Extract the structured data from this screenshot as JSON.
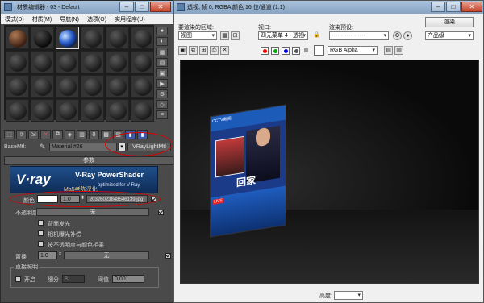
{
  "material_editor": {
    "title": "材质编辑器 - 03 - Default",
    "menu": [
      "模式(D)",
      "材质(M)",
      "导航(N)",
      "选项(O)",
      "实用程序(U)"
    ],
    "basemtl_label": "BaseMtl:",
    "material_name": "Material #26",
    "material_type": "VRayLightMtl",
    "rollout_title": "参数",
    "banner": {
      "logo": "V·ray",
      "title": "V-Ray PowerShader",
      "subtitle": "optimized for V-Ray",
      "extra": "Ma5老陈汉化"
    },
    "color_label": "颜色",
    "color_multiplier": "1.0",
    "texture_name": "20326023848546139.jpg)",
    "opacity_label": "不透明度",
    "opacity_map": "无",
    "checkboxes": [
      {
        "label": "背面发光",
        "checked": false
      },
      {
        "label": "相机曝光补偿",
        "checked": false
      },
      {
        "label": "按不透明度与颜色相乘",
        "checked": false
      }
    ],
    "displace_label": "置换",
    "displace_value": "1.0",
    "displace_map": "无",
    "direct_group_title": "直接照明",
    "direct_on_label": "开启",
    "subdiv_label": "细分",
    "subdiv_value": "8",
    "threshold_label": "阈值",
    "threshold_value": "0.001"
  },
  "render_window": {
    "title": "透视, 帧 0, RGBA 颜色 16 位/通道 (1:1)",
    "area_label": "要渲染的区域:",
    "area_value": "视图",
    "viewport_label": "视口:",
    "viewport_value": "四元菜单 4 - 透视",
    "preset_label": "渲染预设:",
    "preset_value": "------------------",
    "render_button": "渲染",
    "quality_value": "产品级",
    "channel_value": "RGB Alpha",
    "bottom_label": "高度:"
  },
  "tv_screen": {
    "logo": "CCTV新闻",
    "caption": "回家",
    "tag": "LIVE"
  },
  "colors": {
    "annotation_red": "#dd0000",
    "vray_blue": "#1f4f8a"
  }
}
